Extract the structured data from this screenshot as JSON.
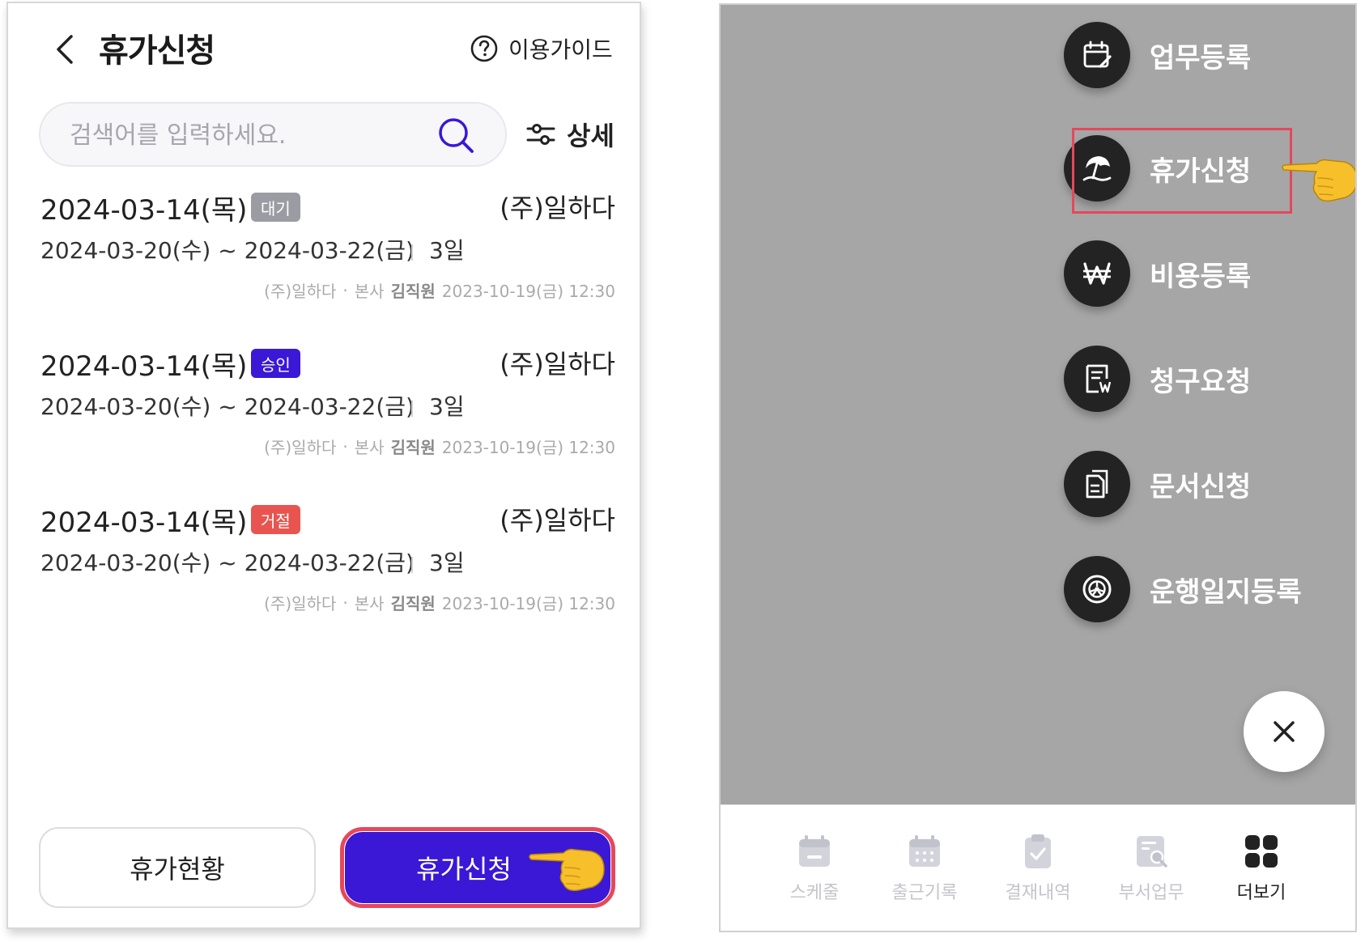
{
  "left_screen": {
    "header": {
      "back_icon": "chevron-left-icon",
      "title": "휴가신청",
      "guide_icon": "question-circle-icon",
      "guide_label": "이용가이드"
    },
    "search": {
      "placeholder": "검색어를 입력하세요.",
      "value": "",
      "search_icon": "search-icon",
      "filter_icon": "sliders-icon",
      "detail_label": "상세"
    },
    "items": [
      {
        "date": "2024-03-14(목)",
        "status": "대기",
        "status_color": "#9b9ba3",
        "company": "(주)일하다",
        "range": "2024-03-20(수) ~ 2024-03-22(금)",
        "days": "3일",
        "meta_company": "(주)일하다",
        "meta_dot": "·",
        "meta_branch": "본사",
        "meta_employee": "김직원",
        "meta_timestamp": "2023-10-19(금) 12:30"
      },
      {
        "date": "2024-03-14(목)",
        "status": "승인",
        "status_color": "#3b17d6",
        "company": "(주)일하다",
        "range": "2024-03-20(수) ~ 2024-03-22(금)",
        "days": "3일",
        "meta_company": "(주)일하다",
        "meta_dot": "·",
        "meta_branch": "본사",
        "meta_employee": "김직원",
        "meta_timestamp": "2023-10-19(금) 12:30"
      },
      {
        "date": "2024-03-14(목)",
        "status": "거절",
        "status_color": "#e8544f",
        "company": "(주)일하다",
        "range": "2024-03-20(수) ~ 2024-03-22(금)",
        "days": "3일",
        "meta_company": "(주)일하다",
        "meta_dot": "·",
        "meta_branch": "본사",
        "meta_employee": "김직원",
        "meta_timestamp": "2023-10-19(금) 12:30"
      }
    ],
    "footer": {
      "status_button": "휴가현황",
      "apply_button": "휴가신청",
      "apply_color": "#3b17d6",
      "highlight_color": "#e5485b",
      "pointer_icon": "pointing-hand-icon"
    }
  },
  "right_screen": {
    "overlay_color": "#a6a6a6",
    "menu": [
      {
        "label": "업무등록",
        "icon": "calendar-edit-icon"
      },
      {
        "label": "휴가신청",
        "icon": "beach-umbrella-icon",
        "highlighted": true
      },
      {
        "label": "비용등록",
        "icon": "won-icon"
      },
      {
        "label": "청구요청",
        "icon": "invoice-won-icon"
      },
      {
        "label": "문서신청",
        "icon": "document-icon"
      },
      {
        "label": "운행일지등록",
        "icon": "steering-wheel-icon"
      }
    ],
    "close_icon": "close-icon",
    "tabs": [
      {
        "label": "스케줄",
        "icon": "calendar-icon"
      },
      {
        "label": "출근기록",
        "icon": "calendar-grid-icon"
      },
      {
        "label": "결재내역",
        "icon": "clipboard-check-icon"
      },
      {
        "label": "부서업무",
        "icon": "document-search-icon"
      },
      {
        "label": "더보기",
        "icon": "grid-icon",
        "active": true
      }
    ]
  }
}
